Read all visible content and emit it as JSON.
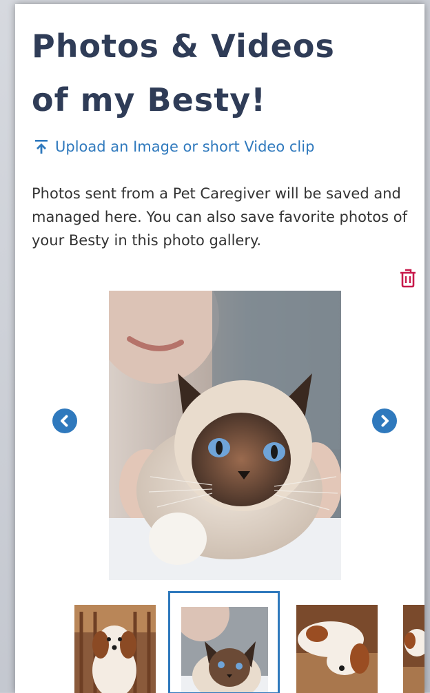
{
  "page": {
    "title_line1": "Photos & Videos",
    "title_line2": "of my Besty!",
    "upload_label": "Upload an Image or short Video clip",
    "description": "Photos sent from a Pet Caregiver will be saved and managed here. You can also save favorite photos of your Besty in this photo gallery."
  },
  "icons": {
    "upload": "upload-arrow-icon",
    "trash": "trash-icon",
    "prev": "chevron-left-circle-icon",
    "next": "chevron-right-circle-icon"
  },
  "gallery": {
    "selected_index": 1,
    "thumbnails": [
      {
        "subject": "dog"
      },
      {
        "subject": "cat"
      },
      {
        "subject": "dog"
      },
      {
        "subject": "dog"
      }
    ]
  },
  "colors": {
    "title": "#2f3c57",
    "accent": "#2f79bd",
    "danger": "#c8194b",
    "text": "#333333"
  }
}
